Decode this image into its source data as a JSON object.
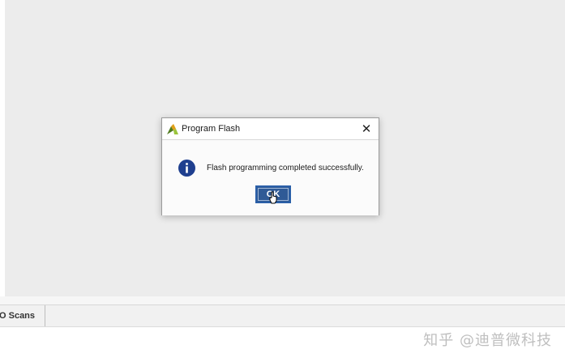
{
  "dialog": {
    "title": "Program Flash",
    "close_label": "✕",
    "message": "Flash programming completed successfully.",
    "ok_label": "OK",
    "icons": {
      "app": "vivado-logo-icon",
      "message": "info-icon",
      "pointer": "hand-cursor-icon"
    }
  },
  "bottom_tabs": {
    "items": [
      {
        "label": "O Scans"
      }
    ]
  },
  "watermark": {
    "text": "知乎 @迪普微科技"
  },
  "colors": {
    "workspace_bg": "#ececec",
    "button_blue": "#2f5a96",
    "info_blue": "#1f3f8f"
  }
}
